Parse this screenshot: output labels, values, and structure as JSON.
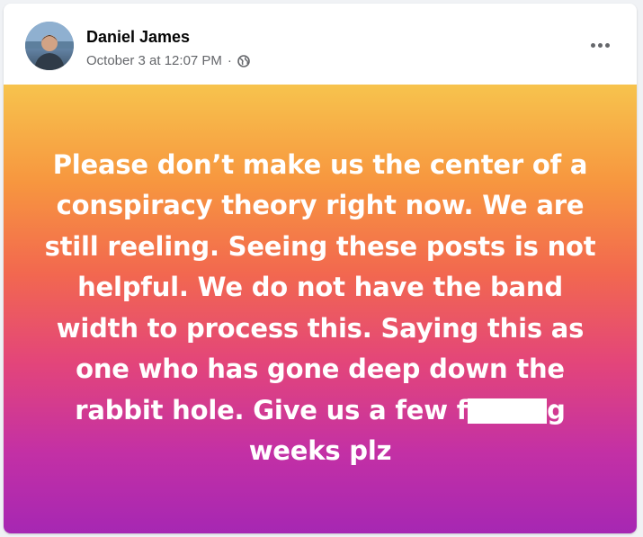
{
  "post": {
    "author": "Daniel James",
    "timestamp": "October 3 at 12:07 PM",
    "separator": "·",
    "privacy_icon": "globe-icon",
    "more_icon": "more-options-icon",
    "text_before_redaction": "Please don’t make us the center of a conspiracy theory right now. We are still reeling. Seeing these posts is not helpful. We do not have the band width to process this. Saying this as one who has gone deep down the rabbit hole. Give us a few f",
    "text_after_redaction": "g weeks plz",
    "background_gradient": [
      "#f7c34d",
      "#f7963f",
      "#f2684f",
      "#e3457a",
      "#c330a5",
      "#a627b3"
    ]
  }
}
